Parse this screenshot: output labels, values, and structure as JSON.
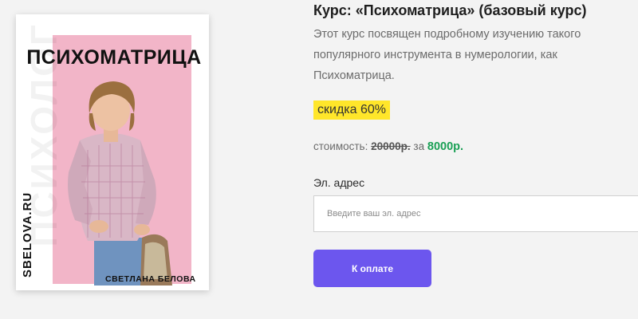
{
  "cover": {
    "title": "ПСИХОМАТРИЦА",
    "site": "SBELOVA.RU",
    "author": "СВЕТЛАНА БЕЛОВА",
    "watermark": "ПСИХОЛОГ",
    "accent_color": "#f2b5c8"
  },
  "course": {
    "title": "Курс: «Психоматрица» (базовый курс)",
    "description": "Этот курс посвящен подробному изучению такого популярного инструмента в нумерологии, как Психоматрица.",
    "discount": "скидка 60%",
    "price_label": "стоимость:",
    "old_price": "20000р.",
    "price_separator": "за",
    "new_price": "8000р."
  },
  "form": {
    "email_label": "Эл. адрес",
    "email_placeholder": "Введите ваш эл. адрес",
    "email_value": "",
    "submit_label": "К оплате",
    "button_color": "#6c56ee"
  }
}
